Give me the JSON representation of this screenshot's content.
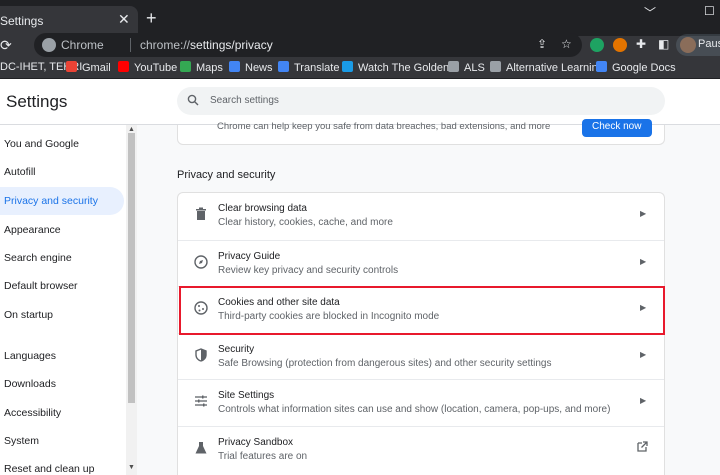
{
  "browser": {
    "tab_title": "Settings",
    "tab_close": "✕",
    "new_tab": "+",
    "window_min": "﹀",
    "window_max": "☐",
    "reload": "⟳",
    "chip_label": "Chrome",
    "url_prefix": "chrome://",
    "url_path": "settings/privacy",
    "profile_label": "Pause",
    "extension_colors": [
      "#1ea362",
      "#e37400",
      "#e8eaed",
      "#e8eaed"
    ]
  },
  "bookmarks": [
    {
      "label": "DC-IHET, TEHRI",
      "icon_color": "#35363a"
    },
    {
      "label": "Gmail",
      "icon_color": "#ea4335"
    },
    {
      "label": "YouTube",
      "icon_color": "#ff0000"
    },
    {
      "label": "Maps",
      "icon_color": "#34a853"
    },
    {
      "label": "News",
      "icon_color": "#4285f4"
    },
    {
      "label": "Translate",
      "icon_color": "#4285f4"
    },
    {
      "label": "Watch The Golden...",
      "icon_color": "#1a9be6"
    },
    {
      "label": "ALS",
      "icon_color": "#9aa0a6"
    },
    {
      "label": "Alternative Learnin...",
      "icon_color": "#9aa0a6"
    },
    {
      "label": "Google Docs",
      "icon_color": "#4285f4"
    }
  ],
  "settings": {
    "title": "Settings",
    "search_placeholder": "Search settings",
    "sidebar": [
      {
        "label": "You and Google",
        "active": false
      },
      {
        "label": "Autofill",
        "active": false
      },
      {
        "label": "Privacy and security",
        "active": true
      },
      {
        "label": "Appearance",
        "active": false
      },
      {
        "label": "Search engine",
        "active": false
      },
      {
        "label": "Default browser",
        "active": false
      },
      {
        "label": "On startup",
        "active": false
      },
      {
        "label": "Languages",
        "active": false
      },
      {
        "label": "Downloads",
        "active": false
      },
      {
        "label": "Accessibility",
        "active": false
      },
      {
        "label": "System",
        "active": false
      },
      {
        "label": "Reset and clean up",
        "active": false
      }
    ],
    "safety_check_text": "Chrome can help keep you safe from data breaches, bad extensions, and more",
    "check_now_label": "Check now",
    "section_title": "Privacy and security",
    "rows": [
      {
        "title": "Clear browsing data",
        "subtitle": "Clear history, cookies, cache, and more",
        "icon": "trash-icon"
      },
      {
        "title": "Privacy Guide",
        "subtitle": "Review key privacy and security controls",
        "icon": "compass-icon"
      },
      {
        "title": "Cookies and other site data",
        "subtitle": "Third-party cookies are blocked in Incognito mode",
        "icon": "cookie-icon"
      },
      {
        "title": "Security",
        "subtitle": "Safe Browsing (protection from dangerous sites) and other security settings",
        "icon": "shield-icon"
      },
      {
        "title": "Site Settings",
        "subtitle": "Controls what information sites can use and show (location, camera, pop-ups, and more)",
        "icon": "sliders-icon"
      },
      {
        "title": "Privacy Sandbox",
        "subtitle": "Trial features are on",
        "icon": "flask-icon"
      }
    ],
    "accent_color": "#1a73e8",
    "highlight_color": "#e8192c"
  }
}
